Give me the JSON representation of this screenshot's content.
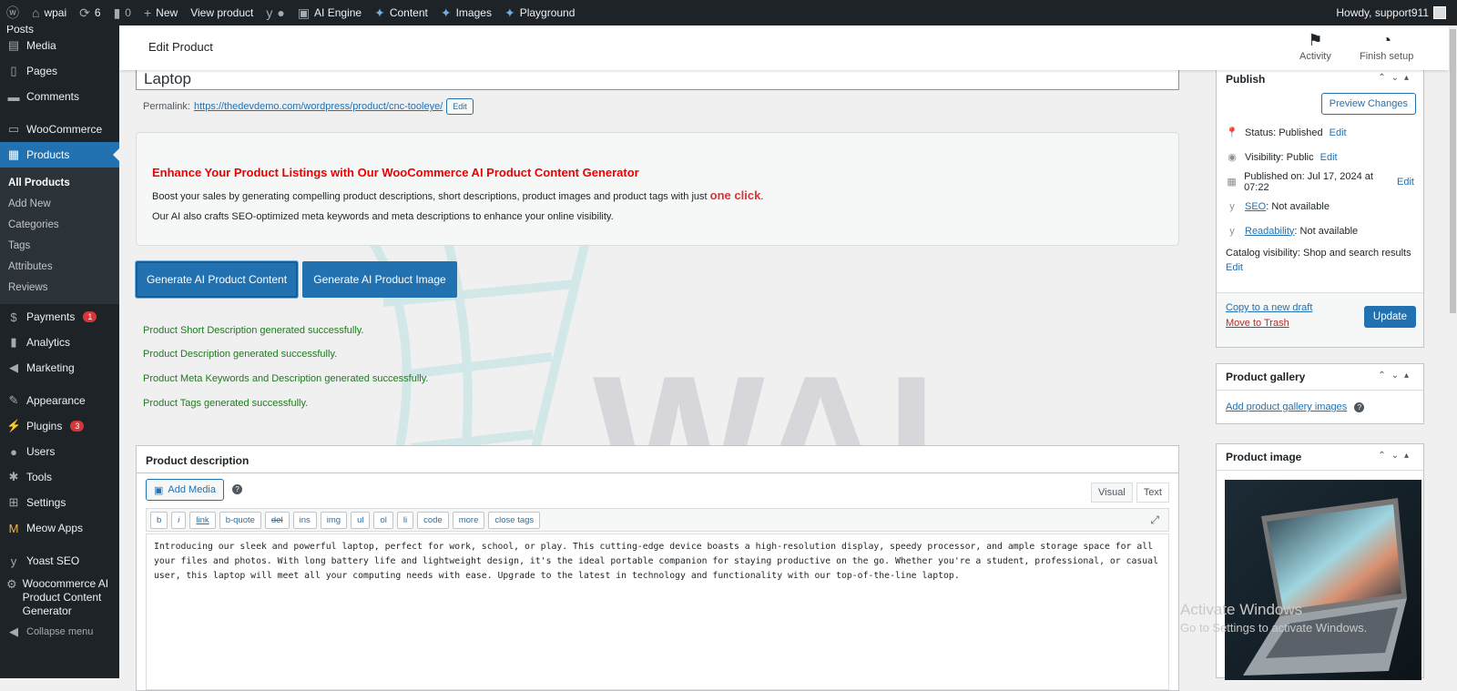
{
  "admin_bar": {
    "site": "wpai",
    "updates": "6",
    "comments": "0",
    "new": "New",
    "view": "View product",
    "ai_engine": "AI Engine",
    "content": "Content",
    "images": "Images",
    "playground": "Playground",
    "howdy": "Howdy, support911"
  },
  "sidebar": {
    "top_partial": "Posts",
    "media": "Media",
    "pages": "Pages",
    "comments": "Comments",
    "woocommerce": "WooCommerce",
    "products": "Products",
    "sub": [
      "All Products",
      "Add New",
      "Categories",
      "Tags",
      "Attributes",
      "Reviews"
    ],
    "payments": "Payments",
    "payments_badge": "1",
    "analytics": "Analytics",
    "marketing": "Marketing",
    "appearance": "Appearance",
    "plugins": "Plugins",
    "plugins_badge": "3",
    "users": "Users",
    "tools": "Tools",
    "settings": "Settings",
    "meow": "Meow Apps",
    "yoast": "Yoast SEO",
    "wcai": "Woocommerce AI Product Content Generator",
    "collapse": "Collapse menu"
  },
  "header": {
    "title": "Edit Product",
    "activity": "Activity",
    "finish": "Finish setup"
  },
  "product": {
    "title": "Laptop",
    "permalink_label": "Permalink:",
    "permalink_url": "https://thedevdemo.com/wordpress/product/cnc-tooleye/",
    "edit": "Edit"
  },
  "promo": {
    "heading": "Enhance Your Product Listings with Our WooCommerce AI Product Content Generator",
    "line1": "Boost your sales by generating compelling product descriptions, short descriptions, product images and product tags with just ",
    "line1_bold": "one click",
    "line1_end": ".",
    "line2": "Our AI also crafts SEO-optimized meta keywords and meta descriptions to enhance your online visibility."
  },
  "buttons": {
    "gen_content": "Generate AI Product Content",
    "gen_image": "Generate AI Product Image"
  },
  "messages": [
    "Product Short Description generated successfully.",
    "Product Description generated successfully.",
    "Product Meta Keywords and Description generated successfully.",
    "Product Tags generated successfully."
  ],
  "watermark": "WAI",
  "description": {
    "heading": "Product description",
    "add_media": "Add Media",
    "visual": "Visual",
    "text": "Text",
    "quicktags": [
      "b",
      "i",
      "link",
      "b-quote",
      "del",
      "ins",
      "img",
      "ul",
      "ol",
      "li",
      "code",
      "more",
      "close tags"
    ],
    "body": "Introducing our sleek and powerful laptop, perfect for work, school, or play. This cutting-edge device boasts a high-resolution display, speedy processor, and ample storage space for all your files and photos. With long battery life and lightweight design, it's the ideal portable companion for staying productive on the go. Whether you're a student, professional, or casual user, this laptop will meet all your computing needs with ease. Upgrade to the latest in technology and functionality with our top-of-the-line laptop."
  },
  "publish": {
    "heading": "Publish",
    "preview": "Preview Changes",
    "status": "Status: Published",
    "visibility": "Visibility: Public",
    "published": "Published on: Jul 17, 2024 at 07:22",
    "seo_link": "SEO",
    "seo": ": Not available",
    "read_link": "Readability",
    "read": ": Not available",
    "catalog": "Catalog visibility: Shop and search results",
    "edit": "Edit",
    "copy": "Copy to a new draft",
    "trash": "Move to Trash",
    "update": "Update"
  },
  "gallery": {
    "heading": "Product gallery",
    "add": "Add product gallery images"
  },
  "image": {
    "heading": "Product image"
  },
  "windows": {
    "line1": "Activate Windows",
    "line2": "Go to Settings to activate Windows."
  }
}
